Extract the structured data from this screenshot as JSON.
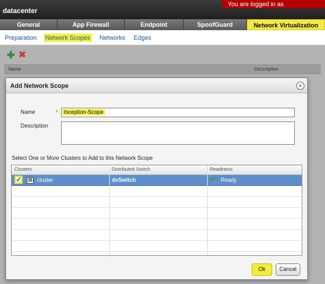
{
  "header": {
    "title": "datacenter",
    "logged_in": "You are logged in as"
  },
  "main_tabs": [
    {
      "label": "General"
    },
    {
      "label": "App Firewall"
    },
    {
      "label": "Endpoint"
    },
    {
      "label": "SpoofGuard"
    },
    {
      "label": "Network Virtualization"
    }
  ],
  "sub_nav": [
    {
      "label": "Preparation"
    },
    {
      "label": "Network Scopes"
    },
    {
      "label": "Networks"
    },
    {
      "label": "Edges"
    }
  ],
  "background_table": {
    "columns": [
      "Name",
      "Description"
    ]
  },
  "dialog": {
    "title": "Add Network Scope",
    "close": "×",
    "name_label": "Name",
    "required_mark": "*",
    "name_value": "Inception-Scope",
    "description_label": "Description",
    "description_value": "",
    "clusters_prompt": "Select One or More Clusters to Add to this Network Scope",
    "grid": {
      "columns": [
        "Clusters",
        "Distributed Switch",
        "Readiness"
      ],
      "rows": [
        {
          "checked": true,
          "cluster": "cluster",
          "switch": "dvSwitch",
          "readiness": "Ready"
        }
      ]
    },
    "ok_label": "Ok",
    "cancel_label": "Cancel"
  },
  "colors": {
    "highlight": "#f4ee3a",
    "selected_row": "#5c8fcb",
    "banner_red": "#b40000"
  },
  "icons": {
    "add": "plus-icon",
    "delete": "x-icon",
    "close": "close-icon",
    "cluster": "cluster-icon",
    "ready": "checkmark-icon"
  }
}
